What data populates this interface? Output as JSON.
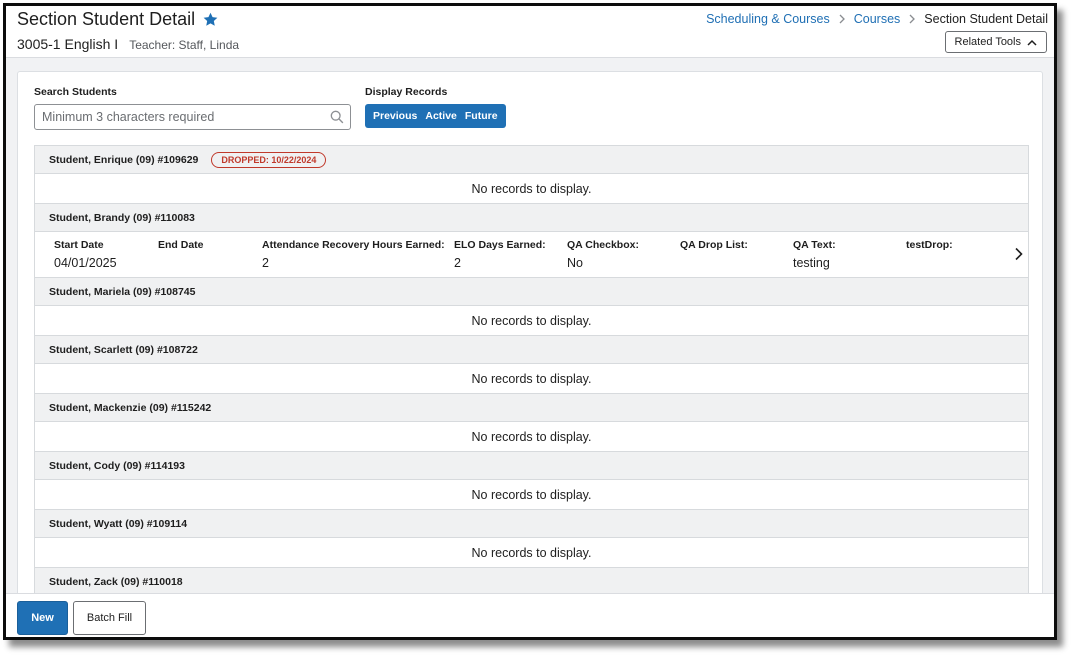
{
  "header": {
    "title": "Section Student Detail",
    "course": "3005-1 English I",
    "teacher": "Teacher: Staff, Linda",
    "breadcrumbs": [
      "Scheduling & Courses",
      "Courses",
      "Section Student Detail"
    ],
    "related_tools": "Related Tools",
    "star_icon": "star-icon",
    "accent": "#1f70b5"
  },
  "filters": {
    "search_label": "Search Students",
    "search_placeholder": "Minimum 3 characters required",
    "search_value": "",
    "display_label": "Display Records",
    "display_options": [
      "Previous",
      "Active",
      "Future"
    ]
  },
  "students": [
    {
      "name": "Student, Enrique (09) #109629",
      "badge": "DROPPED: 10/22/2024",
      "empty_text": "No records to display."
    },
    {
      "name": "Student, Brandy (09) #110083"
    },
    {
      "name": "Student, Mariela (09) #108745",
      "empty_text": "No records to display."
    },
    {
      "name": "Student, Scarlett (09) #108722",
      "empty_text": "No records to display."
    },
    {
      "name": "Student, Mackenzie (09) #115242",
      "empty_text": "No records to display."
    },
    {
      "name": "Student, Cody (09) #114193",
      "empty_text": "No records to display."
    },
    {
      "name": "Student, Wyatt (09) #109114",
      "empty_text": "No records to display."
    },
    {
      "name": "Student, Zack (09) #110018"
    }
  ],
  "record": {
    "columns": [
      {
        "header": "Start Date",
        "value": "04/01/2025"
      },
      {
        "header": "End Date",
        "value": ""
      },
      {
        "header": "Attendance Recovery Hours Earned:",
        "value": "2"
      },
      {
        "header": "ELO Days Earned:",
        "value": "2"
      },
      {
        "header": "QA Checkbox:",
        "value": "No"
      },
      {
        "header": "QA Drop List:",
        "value": ""
      },
      {
        "header": "QA Text:",
        "value": "testing"
      },
      {
        "header": "testDrop:",
        "value": ""
      }
    ]
  },
  "footer": {
    "new_label": "New",
    "batch_fill_label": "Batch Fill"
  },
  "colors": {
    "dropped_badge": "#c0392b",
    "link": "#1f6fb4"
  }
}
